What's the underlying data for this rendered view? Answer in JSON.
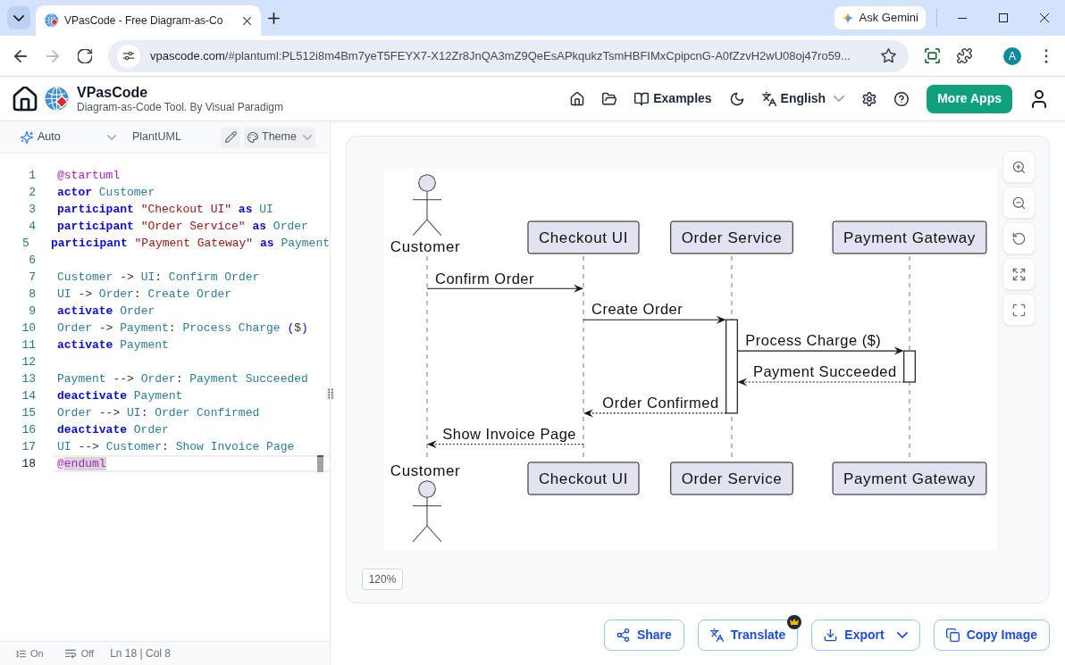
{
  "browser": {
    "tab": {
      "title": "VPasCode - Free Diagram-as-Co"
    },
    "gemini_label": "Ask Gemini",
    "nav": [
      {
        "kind": "back",
        "disabled": false
      },
      {
        "kind": "forward",
        "disabled": true
      },
      {
        "kind": "reload",
        "disabled": false
      }
    ],
    "address": {
      "host": "vpascode.com",
      "path": "/#plantuml:PL512i8m4Bm7yeT5FEYX7-X12Zr8JnQA3mZ9QeEsAPkqukzTsmHBFIMxCpipcnG-A0fZzvH2wU08oj47ro59..."
    },
    "profile_initial": "A"
  },
  "app": {
    "name": "VPasCode",
    "tagline": "Diagram-as-Code Tool. By Visual Paradigm",
    "nav": [
      {
        "kind": "home"
      },
      {
        "kind": "open"
      },
      {
        "kind": "examples",
        "label": "Examples"
      },
      {
        "kind": "dark_mode"
      },
      {
        "kind": "language",
        "label": "English"
      },
      {
        "kind": "settings"
      },
      {
        "kind": "help"
      }
    ],
    "cta": "More Apps"
  },
  "editor": {
    "toolbar": {
      "mode": "Auto",
      "language": "PlantUML",
      "theme": "Theme"
    },
    "lines": [
      {
        "number": "1",
        "current": false,
        "tokens": [
          {
            "kind": "directive",
            "text": "@startuml",
            "highlighted": false
          }
        ]
      },
      {
        "number": "2",
        "current": false,
        "tokens": [
          {
            "kind": "keyword",
            "text": "actor",
            "highlighted": false
          },
          {
            "kind": "name",
            "text": " Customer",
            "highlighted": false
          }
        ]
      },
      {
        "number": "3",
        "current": false,
        "tokens": [
          {
            "kind": "keyword",
            "text": "participant",
            "highlighted": false
          },
          {
            "kind": "string",
            "text": " \"Checkout UI\"",
            "highlighted": false
          },
          {
            "kind": "keyword",
            "text": " as",
            "highlighted": false
          },
          {
            "kind": "name",
            "text": " UI",
            "highlighted": false
          }
        ]
      },
      {
        "number": "4",
        "current": false,
        "tokens": [
          {
            "kind": "keyword",
            "text": "participant",
            "highlighted": false
          },
          {
            "kind": "string",
            "text": " \"Order Service\"",
            "highlighted": false
          },
          {
            "kind": "keyword",
            "text": " as",
            "highlighted": false
          },
          {
            "kind": "name",
            "text": " Order",
            "highlighted": false
          }
        ]
      },
      {
        "number": "5",
        "current": false,
        "tokens": [
          {
            "kind": "keyword",
            "text": "participant",
            "highlighted": false
          },
          {
            "kind": "string",
            "text": " \"Payment Gateway\"",
            "highlighted": false
          },
          {
            "kind": "keyword",
            "text": " as",
            "highlighted": false
          },
          {
            "kind": "name",
            "text": " Payment",
            "highlighted": false
          }
        ]
      },
      {
        "number": "6",
        "current": false
      },
      {
        "number": "7",
        "current": false,
        "tokens": [
          {
            "kind": "name",
            "text": "Customer",
            "highlighted": false
          },
          {
            "kind": "operator",
            "text": " -> ",
            "highlighted": false
          },
          {
            "kind": "name",
            "text": "UI",
            "highlighted": false
          },
          {
            "kind": "operator",
            "text": ":",
            "highlighted": false
          },
          {
            "kind": "name",
            "text": " Confirm Order",
            "highlighted": false
          }
        ]
      },
      {
        "number": "8",
        "current": false,
        "tokens": [
          {
            "kind": "name",
            "text": "UI",
            "highlighted": false
          },
          {
            "kind": "operator",
            "text": " -> ",
            "highlighted": false
          },
          {
            "kind": "name",
            "text": "Order",
            "highlighted": false
          },
          {
            "kind": "operator",
            "text": ":",
            "highlighted": false
          },
          {
            "kind": "name",
            "text": " Create Order",
            "highlighted": false
          }
        ]
      },
      {
        "number": "9",
        "current": false,
        "tokens": [
          {
            "kind": "keyword",
            "text": "activate",
            "highlighted": false
          },
          {
            "kind": "name",
            "text": " Order",
            "highlighted": false
          }
        ]
      },
      {
        "number": "10",
        "current": false,
        "tokens": [
          {
            "kind": "name",
            "text": "Order",
            "highlighted": false
          },
          {
            "kind": "operator",
            "text": " -> ",
            "highlighted": false
          },
          {
            "kind": "name",
            "text": "Payment",
            "highlighted": false
          },
          {
            "kind": "operator",
            "text": ":",
            "highlighted": false
          },
          {
            "kind": "name",
            "text": " Process Charge ",
            "highlighted": false
          },
          {
            "kind": "paren",
            "text": "(",
            "highlighted": false
          },
          {
            "kind": "operator",
            "text": "$",
            "highlighted": false
          },
          {
            "kind": "paren",
            "text": ")",
            "highlighted": false
          }
        ]
      },
      {
        "number": "11",
        "current": false,
        "tokens": [
          {
            "kind": "keyword",
            "text": "activate",
            "highlighted": false
          },
          {
            "kind": "name",
            "text": " Payment",
            "highlighted": false
          }
        ]
      },
      {
        "number": "12",
        "current": false
      },
      {
        "number": "13",
        "current": false,
        "tokens": [
          {
            "kind": "name",
            "text": "Payment",
            "highlighted": false
          },
          {
            "kind": "operator",
            "text": " --> ",
            "highlighted": false
          },
          {
            "kind": "name",
            "text": "Order",
            "highlighted": false
          },
          {
            "kind": "operator",
            "text": ":",
            "highlighted": false
          },
          {
            "kind": "name",
            "text": " Payment Succeeded",
            "highlighted": false
          }
        ]
      },
      {
        "number": "14",
        "current": false,
        "tokens": [
          {
            "kind": "keyword",
            "text": "deactivate",
            "highlighted": false
          },
          {
            "kind": "name",
            "text": " Payment",
            "highlighted": false
          }
        ]
      },
      {
        "number": "15",
        "current": false,
        "tokens": [
          {
            "kind": "name",
            "text": "Order",
            "highlighted": false
          },
          {
            "kind": "operator",
            "text": " --> ",
            "highlighted": false
          },
          {
            "kind": "name",
            "text": "UI",
            "highlighted": false
          },
          {
            "kind": "operator",
            "text": ":",
            "highlighted": false
          },
          {
            "kind": "name",
            "text": " Order Confirmed",
            "highlighted": false
          }
        ]
      },
      {
        "number": "16",
        "current": false,
        "tokens": [
          {
            "kind": "keyword",
            "text": "deactivate",
            "highlighted": false
          },
          {
            "kind": "name",
            "text": " Order",
            "highlighted": false
          }
        ]
      },
      {
        "number": "17",
        "current": false,
        "tokens": [
          {
            "kind": "name",
            "text": "UI",
            "highlighted": false
          },
          {
            "kind": "operator",
            "text": " --> ",
            "highlighted": false
          },
          {
            "kind": "name",
            "text": "Customer",
            "highlighted": false
          },
          {
            "kind": "operator",
            "text": ":",
            "highlighted": false
          },
          {
            "kind": "name",
            "text": " Show Invoice Page",
            "highlighted": false
          }
        ]
      },
      {
        "number": "18",
        "current": true,
        "tokens": [
          {
            "kind": "directive",
            "text": "@",
            "highlighted": false
          },
          {
            "kind": "directive",
            "text": "enduml",
            "highlighted": true
          }
        ]
      }
    ],
    "status": {
      "line_numbers": "On",
      "word_wrap": "Off",
      "cursor": "Ln 18 | Col 8"
    }
  },
  "preview": {
    "diagram": {
      "participants": [
        {
          "kind": "actor",
          "top_label": "Customer",
          "bottom_label": "Customer"
        },
        {
          "kind": "participant",
          "top_label": "Checkout UI",
          "bottom_label": "Checkout UI"
        },
        {
          "kind": "participant",
          "top_label": "Order Service",
          "bottom_label": "Order Service"
        },
        {
          "kind": "participant",
          "top_label": "Payment Gateway",
          "bottom_label": "Payment Gateway"
        }
      ],
      "messages": [
        {
          "kind": "sync",
          "label": "Confirm Order",
          "leftward": false,
          "activates_target": false,
          "ends_activation": false
        },
        {
          "kind": "sync",
          "label": "Create Order",
          "leftward": false,
          "activates_target": true,
          "ends_activation": false
        },
        {
          "kind": "sync",
          "label": "Process Charge ($)",
          "leftward": false,
          "activates_target": true,
          "ends_activation": false
        },
        {
          "kind": "reply",
          "label": "Payment Succeeded",
          "leftward": true,
          "activates_target": false,
          "ends_activation": true
        },
        {
          "kind": "reply",
          "label": "Order Confirmed",
          "leftward": true,
          "activates_target": false,
          "ends_activation": true
        },
        {
          "kind": "reply",
          "label": "Show Invoice Page",
          "leftward": true,
          "activates_target": false,
          "ends_activation": false
        }
      ]
    },
    "zoom_tools": [
      {
        "kind": "zoom_in"
      },
      {
        "kind": "zoom_out"
      },
      {
        "kind": "reset"
      },
      {
        "kind": "fit"
      },
      {
        "kind": "fullscreen"
      }
    ],
    "zoom_level": "120%",
    "actions": [
      {
        "kind": "share",
        "label": "Share",
        "premium": false,
        "menu": false
      },
      {
        "kind": "translate",
        "label": "Translate",
        "premium": true,
        "menu": false
      },
      {
        "kind": "export",
        "label": "Export",
        "premium": false,
        "menu": true
      },
      {
        "kind": "copy_image",
        "label": "Copy Image",
        "premium": false,
        "menu": false
      }
    ]
  }
}
